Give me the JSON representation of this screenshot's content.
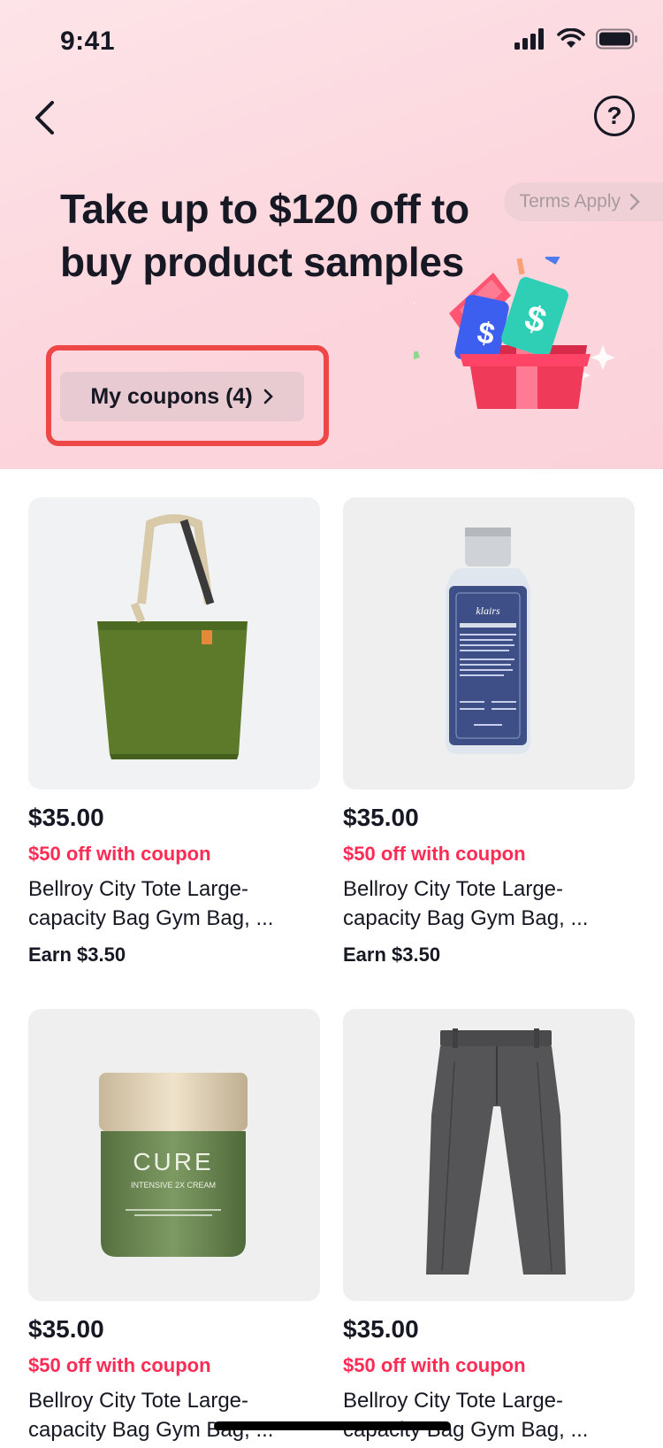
{
  "status_bar": {
    "time": "9:41"
  },
  "header": {
    "terms_label": "Terms Apply"
  },
  "hero": {
    "headline": "Take up to $120 off to buy product samples",
    "coupons_button": "My coupons (4)"
  },
  "products": [
    {
      "price": "$35.00",
      "coupon": "$50 off with coupon",
      "title": "Bellroy City Tote Large-capacity Bag Gym Bag, ...",
      "earn": "Earn $3.50",
      "image": "green-tote-bag"
    },
    {
      "price": "$35.00",
      "coupon": "$50 off with coupon",
      "title": "Bellroy City Tote Large-capacity Bag Gym Bag, ...",
      "earn": "Earn $3.50",
      "image": "toner-bottle"
    },
    {
      "price": "$35.00",
      "coupon": "$50 off with coupon",
      "title": "Bellroy City Tote Large-capacity Bag Gym Bag, ...",
      "earn": "",
      "image": "cream-jar"
    },
    {
      "price": "$35.00",
      "coupon": "$50 off with coupon",
      "title": "Bellroy City Tote Large-capacity Bag Gym Bag, ...",
      "earn": "",
      "image": "grey-trousers"
    }
  ],
  "product_image_text": {
    "toner_brand": "klairs",
    "cream_brand": "CURE",
    "cream_sub": "INTENSIVE 2X CREAM"
  },
  "colors": {
    "accent": "#fe2c55",
    "highlight_frame": "#ee4747",
    "hero_bg": "#fcd6dd"
  }
}
